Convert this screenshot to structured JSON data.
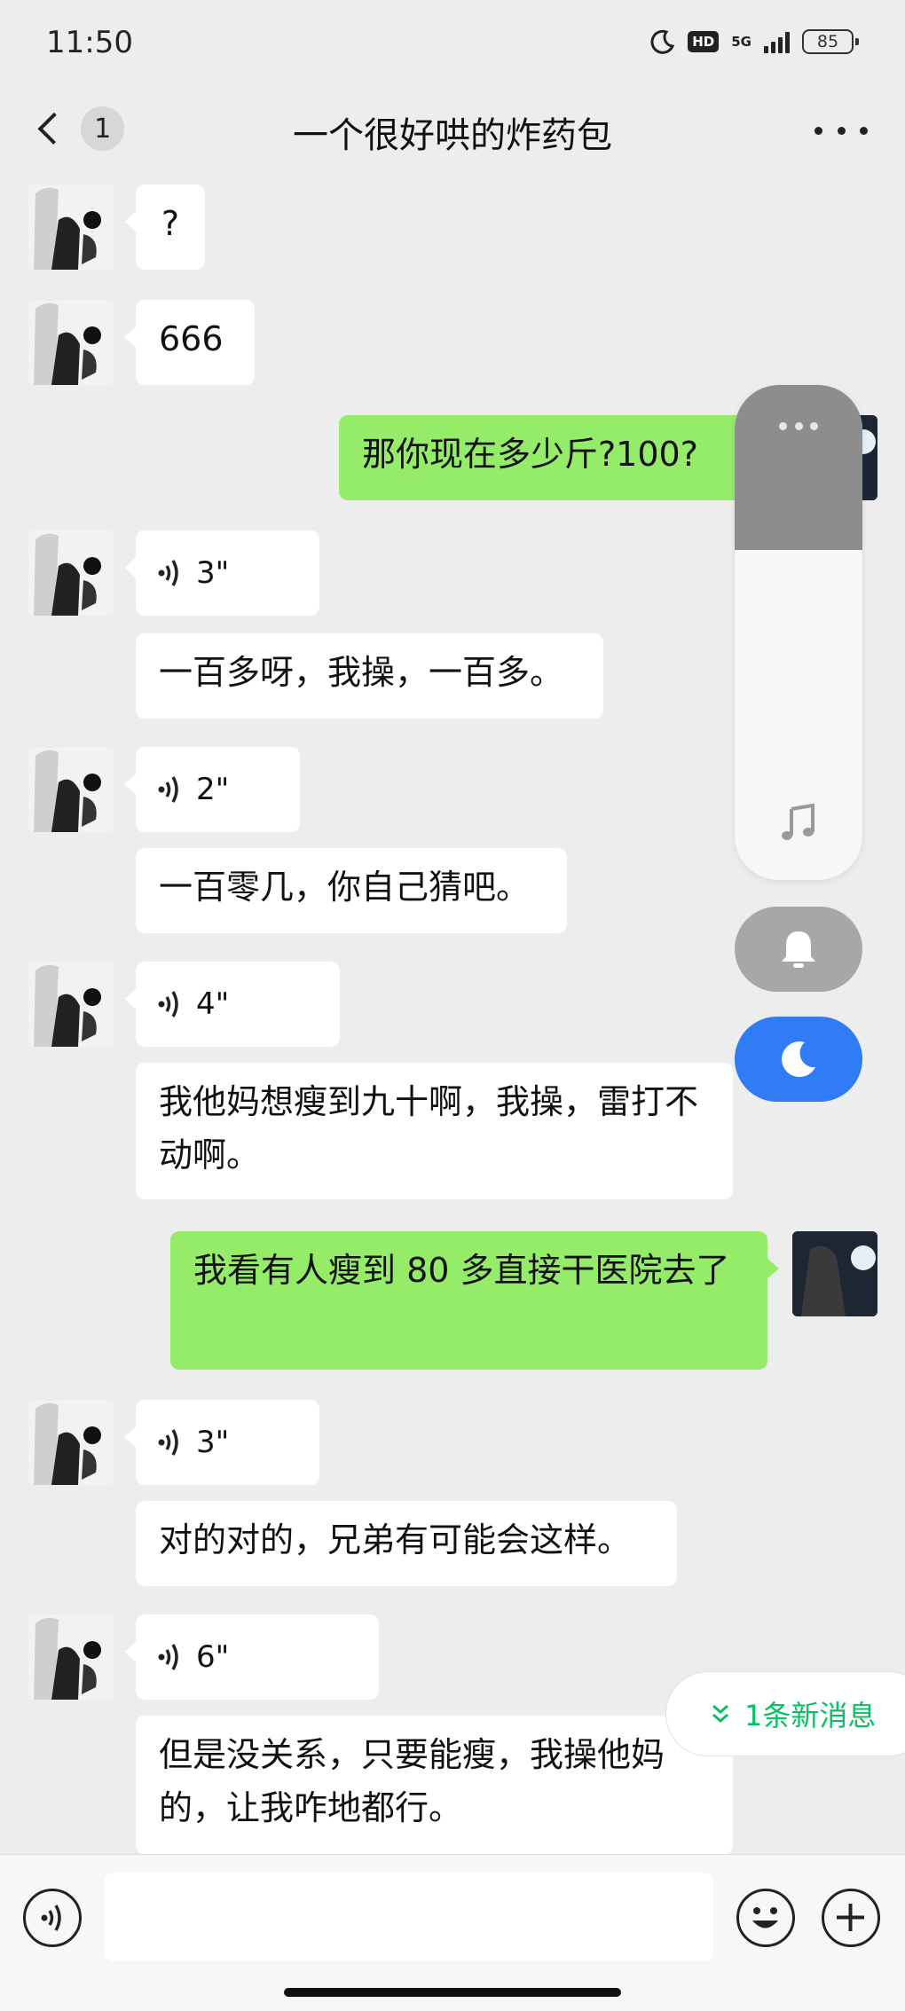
{
  "status_bar": {
    "time": "11:50",
    "network": "5G",
    "hd": "HD",
    "battery": "85"
  },
  "header": {
    "back_count": "1",
    "title": "一个很好哄的炸药包"
  },
  "messages": {
    "m1": "?",
    "m2": "666",
    "m3": "那你现在多少斤?100?",
    "m4_duration": "3\"",
    "m4_text": "一百多呀，我操，一百多。",
    "m5_duration": "2\"",
    "m5_text": "一百零几，你自己猜吧。",
    "m6_duration": "4\"",
    "m6_text": "我他妈想瘦到九十啊，我操，雷打不动啊。",
    "m7": "我看有人瘦到 80 多直接干医院去了",
    "m8_duration": "3\"",
    "m8_text": "对的对的，兄弟有可能会这样。",
    "m9_duration": "6\"",
    "m9_text": "但是没关系，只要能瘦，我操他妈的，让我咋地都行。"
  },
  "new_messages": "1条新消息",
  "colors": {
    "outgoing_bubble": "#95ec69",
    "accent_green": "#07c160",
    "dnd_blue": "#2f7cf6"
  },
  "icons": [
    "back-chevron-icon",
    "more-icon",
    "voice-icon",
    "music-icon",
    "bell-icon",
    "moon-icon",
    "emoji-icon",
    "plus-icon"
  ]
}
